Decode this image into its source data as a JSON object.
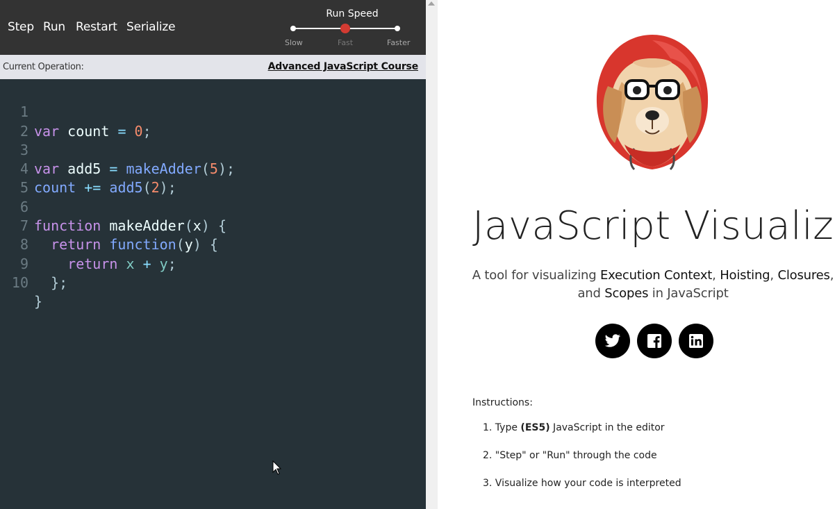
{
  "toolbar": {
    "step": "Step",
    "run": "Run",
    "restart": "Restart",
    "serialize": "Serialize",
    "speed_title": "Run Speed",
    "speed_slow": "Slow",
    "speed_fast": "Fast",
    "speed_faster": "Faster",
    "speed_selected": "Fast"
  },
  "opbar": {
    "label": "Current Operation:",
    "course_link": "Advanced JavaScript Course"
  },
  "editor": {
    "line_numbers": [
      "1",
      "2",
      "3",
      "4",
      "5",
      "6",
      "7",
      "8",
      "9",
      "10"
    ],
    "lines": [
      "var count = 0;",
      "",
      "var add5 = makeAdder(5);",
      "count += add5(2);",
      "",
      "function makeAdder(x) {",
      "  return function(y) {",
      "    return x + y;",
      "  };",
      "}"
    ],
    "theme_colors": {
      "background": "#263238",
      "keyword": "#c792ea",
      "function": "#82aaff",
      "number": "#f78c6c",
      "operator": "#89ddff",
      "variable": "#eeffff"
    }
  },
  "hero": {
    "title": "JavaScript Visualizer",
    "tagline_pre": "A tool for visualizing ",
    "tagline_term1": "Execution Context",
    "tagline_sep1": ", ",
    "tagline_term2": "Hoisting",
    "tagline_sep2": ", ",
    "tagline_term3": "Closures",
    "tagline_sep3": ",",
    "tagline_mid": "and ",
    "tagline_term4": "Scopes",
    "tagline_post": " in JavaScript",
    "logo_icon": "dog-in-red-hoodie-logo"
  },
  "social": {
    "icons": [
      "twitter-icon",
      "facebook-icon",
      "linkedin-icon"
    ]
  },
  "instructions": {
    "title": "Instructions:",
    "item1_pre": "1. Type ",
    "item1_bold": "(ES5)",
    "item1_post": " JavaScript in the editor",
    "item2": "2. \"Step\" or \"Run\" through the code",
    "item3": "3. Visualize how your code is interpreted"
  }
}
